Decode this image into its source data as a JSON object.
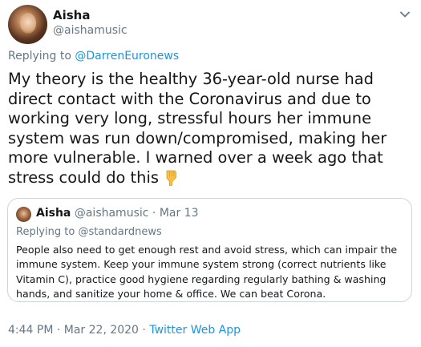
{
  "tweet": {
    "author": {
      "name": "Aisha",
      "handle": "@aishamusic"
    },
    "replying_prefix": "Replying to",
    "replying_to": "@DarrenEuronews",
    "text": "My theory is the healthy 36-year-old nurse had direct contact with the Coronavirus and due to working very long, stressful hours her immune system was run down/compromised, making her more vulnerable. I warned over a week ago that stress could do this",
    "emoji": "backhand-index-pointing-down",
    "timestamp": "4:44 PM · Mar 22, 2020",
    "separator": "·",
    "source": "Twitter Web App"
  },
  "quote": {
    "author": {
      "name": "Aisha",
      "handle": "@aishamusic"
    },
    "separator": "·",
    "date": "Mar 13",
    "replying_prefix": "Replying to",
    "replying_to": "@standardnews",
    "text": "People also need to get enough rest and avoid stress, which can impair the immune system. Keep your immune system strong (correct nutrients like Vitamin C), practice good hygiene regarding regularly bathing & washing hands, and sanitize your home & office. We can beat Corona."
  },
  "colors": {
    "text": "#14171a",
    "secondary": "#657786",
    "link": "#1b95e0",
    "border": "#ccd6dd"
  },
  "icons": {
    "menu": "chevron-down-icon",
    "emoji": "backhand-index-pointing-down"
  }
}
